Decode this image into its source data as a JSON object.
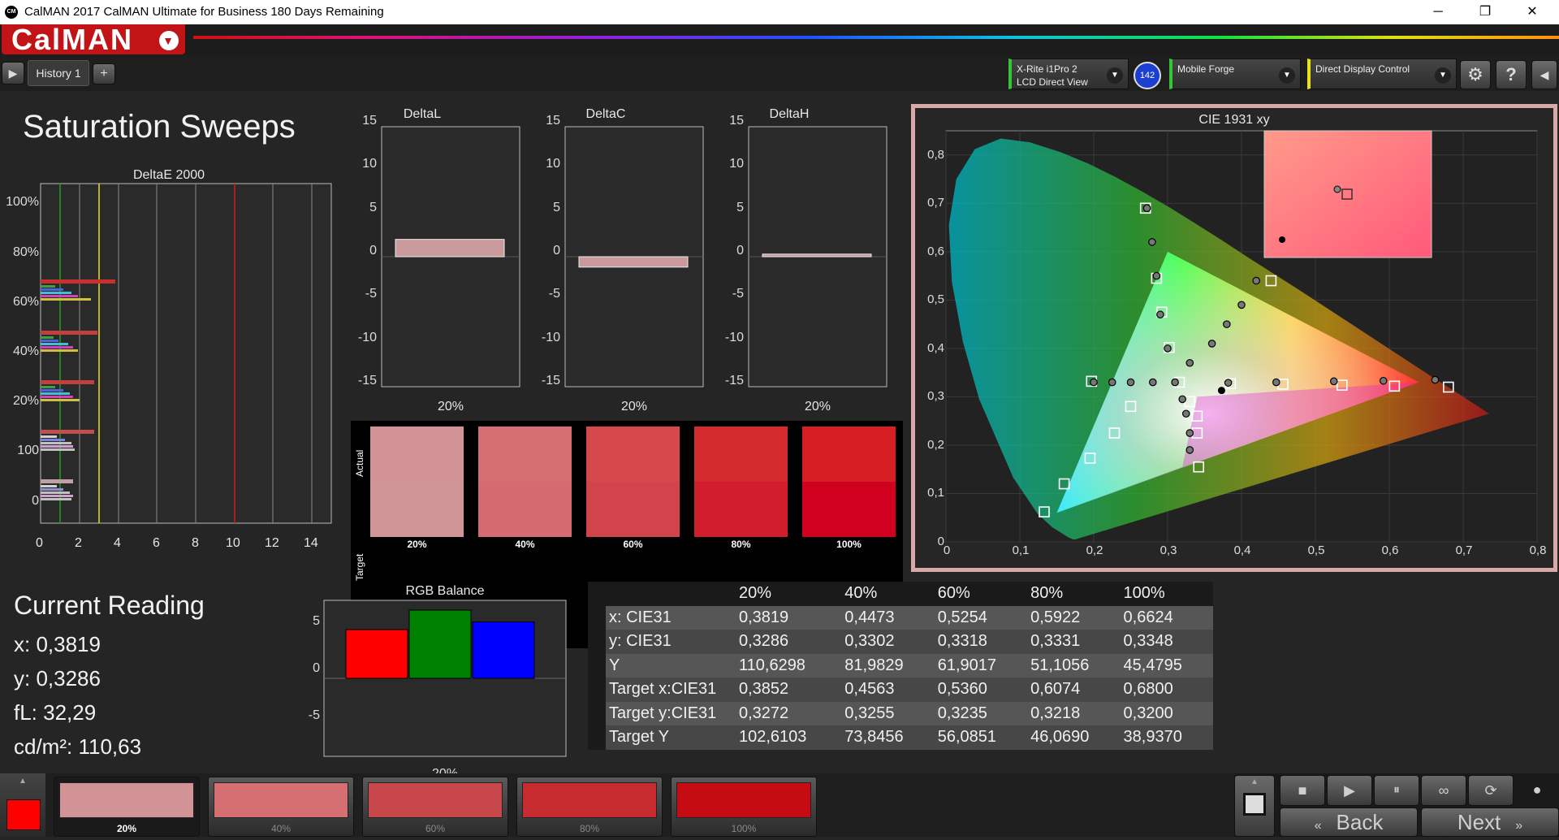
{
  "window": {
    "title": "CalMAN 2017 CalMAN Ultimate for Business 180 Days Remaining",
    "app_icon": "CM",
    "minimize": "─",
    "restore": "❐",
    "close": "✕"
  },
  "brand": {
    "logo": "CalMAN",
    "color": "#c21417"
  },
  "tabs": [
    {
      "label": "History 1"
    }
  ],
  "tab_add": "+",
  "devices": {
    "meter": {
      "line1": "X-Rite i1Pro 2",
      "line2": "LCD Direct View",
      "badge": "142"
    },
    "source": {
      "line1": "Mobile Forge"
    },
    "display": {
      "line1": "Direct Display Control"
    }
  },
  "page_title": "Saturation Sweeps",
  "deltae_chart": {
    "title": "DeltaE 2000",
    "yticks": [
      "100%",
      "80%",
      "60%",
      "40%",
      "20%",
      "100",
      "0"
    ],
    "xticks": [
      "0",
      "2",
      "4",
      "6",
      "8",
      "10",
      "12",
      "14"
    ]
  },
  "chart_data": [
    {
      "type": "bar",
      "title": "DeltaL",
      "categories": [
        "20%"
      ],
      "values": [
        2.0
      ],
      "ylim": [
        -15,
        15
      ],
      "yticks": [
        "15",
        "10",
        "5",
        "0",
        "-5",
        "-10",
        "-15"
      ]
    },
    {
      "type": "bar",
      "title": "DeltaC",
      "categories": [
        "20%"
      ],
      "values": [
        -1.2
      ],
      "ylim": [
        -15,
        15
      ],
      "yticks": [
        "15",
        "10",
        "5",
        "0",
        "-5",
        "-10",
        "-15"
      ]
    },
    {
      "type": "bar",
      "title": "DeltaH",
      "categories": [
        "20%"
      ],
      "values": [
        0.3
      ],
      "ylim": [
        -15,
        15
      ],
      "yticks": [
        "15",
        "10",
        "5",
        "0",
        "-5",
        "-10",
        "-15"
      ]
    },
    {
      "type": "bar",
      "title": "RGB Balance",
      "categories": [
        "20%"
      ],
      "series": [
        {
          "name": "R",
          "values": [
            5.0
          ],
          "color": "#ff0000"
        },
        {
          "name": "G",
          "values": [
            7.0
          ],
          "color": "#008000"
        },
        {
          "name": "B",
          "values": [
            5.8
          ],
          "color": "#0000ff"
        }
      ],
      "yticks": [
        "5",
        "0",
        "-5"
      ],
      "ylim": [
        -8,
        8
      ]
    },
    {
      "type": "scatter",
      "title": "CIE 1931 xy",
      "xticks": [
        "0",
        "0,1",
        "0,2",
        "0,3",
        "0,4",
        "0,5",
        "0,6",
        "0,7",
        "0,8"
      ],
      "yticks": [
        "0",
        "0,1",
        "0,2",
        "0,3",
        "0,4",
        "0,5",
        "0,6",
        "0,7",
        "0,8"
      ],
      "xlim": [
        0,
        0.8
      ],
      "ylim": [
        0,
        0.85
      ],
      "measured": [
        [
          0.382,
          0.329
        ],
        [
          0.447,
          0.33
        ],
        [
          0.525,
          0.332
        ],
        [
          0.592,
          0.333
        ],
        [
          0.662,
          0.335
        ],
        [
          0.272,
          0.69
        ],
        [
          0.279,
          0.62
        ],
        [
          0.285,
          0.55
        ],
        [
          0.29,
          0.47
        ],
        [
          0.3,
          0.4
        ],
        [
          0.33,
          0.37
        ],
        [
          0.36,
          0.41
        ],
        [
          0.38,
          0.45
        ],
        [
          0.4,
          0.49
        ],
        [
          0.42,
          0.54
        ],
        [
          0.2,
          0.33
        ],
        [
          0.225,
          0.33
        ],
        [
          0.25,
          0.33
        ],
        [
          0.28,
          0.33
        ],
        [
          0.32,
          0.295
        ],
        [
          0.325,
          0.265
        ],
        [
          0.33,
          0.225
        ],
        [
          0.33,
          0.19
        ],
        [
          0.31,
          0.33
        ]
      ],
      "targets": [
        [
          0.385,
          0.327
        ],
        [
          0.456,
          0.326
        ],
        [
          0.536,
          0.324
        ],
        [
          0.607,
          0.322
        ],
        [
          0.68,
          0.32
        ],
        [
          0.27,
          0.69
        ],
        [
          0.25,
          0.28
        ],
        [
          0.228,
          0.225
        ],
        [
          0.195,
          0.173
        ],
        [
          0.16,
          0.12
        ],
        [
          0.133,
          0.062
        ],
        [
          0.316,
          0.33
        ],
        [
          0.34,
          0.26
        ],
        [
          0.34,
          0.225
        ],
        [
          0.342,
          0.155
        ],
        [
          0.44,
          0.54
        ],
        [
          0.285,
          0.545
        ],
        [
          0.292,
          0.475
        ],
        [
          0.302,
          0.402
        ],
        [
          0.197,
          0.332
        ],
        [
          0.33,
          0.29
        ]
      ],
      "white": [
        0.373,
        0.313
      ],
      "inset": {
        "measured": [
          0.425,
          0.35
        ],
        "target": [
          0.43,
          0.345
        ],
        "white": [
          0.405,
          0.32
        ]
      }
    }
  ],
  "swatches": {
    "actual_label": "Actual",
    "target_label": "Target",
    "items": [
      {
        "label": "20%",
        "actual": "#d19395",
        "target": "#d09597"
      },
      {
        "label": "40%",
        "actual": "#d66f72",
        "target": "#d36b70"
      },
      {
        "label": "60%",
        "actual": "#d5484c",
        "target": "#d2444c"
      },
      {
        "label": "80%",
        "actual": "#d42b2f",
        "target": "#d21e2c"
      },
      {
        "label": "100%",
        "actual": "#d51f22",
        "target": "#d1001f"
      }
    ]
  },
  "current_reading": {
    "title": "Current Reading",
    "x": "x: 0,3819",
    "y": "y: 0,3286",
    "fl": "fL: 32,29",
    "cdm2": "cd/m²: 110,63"
  },
  "table": {
    "headers": [
      "",
      "20%",
      "40%",
      "60%",
      "80%",
      "100%"
    ],
    "rows": [
      [
        "x: CIE31",
        "0,3819",
        "0,4473",
        "0,5254",
        "0,5922",
        "0,6624"
      ],
      [
        "y: CIE31",
        "0,3286",
        "0,3302",
        "0,3318",
        "0,3331",
        "0,3348"
      ],
      [
        "Y",
        "110,6298",
        "81,9829",
        "61,9017",
        "51,1056",
        "45,4795"
      ],
      [
        "Target x:CIE31",
        "0,3852",
        "0,4563",
        "0,5360",
        "0,6074",
        "0,6800"
      ],
      [
        "Target y:CIE31",
        "0,3272",
        "0,3255",
        "0,3235",
        "0,3218",
        "0,3200"
      ],
      [
        "Target Y",
        "102,6103",
        "73,8456",
        "56,0851",
        "46,0690",
        "38,9370"
      ]
    ]
  },
  "bottom": {
    "current_color": "#ff0000",
    "swatches": [
      {
        "label": "20%",
        "color": "#d19395"
      },
      {
        "label": "40%",
        "color": "#d66f72"
      },
      {
        "label": "60%",
        "color": "#c7474b"
      },
      {
        "label": "80%",
        "color": "#c72a2f"
      },
      {
        "label": "100%",
        "color": "#c40c12"
      }
    ],
    "back": "Back",
    "next": "Next"
  }
}
